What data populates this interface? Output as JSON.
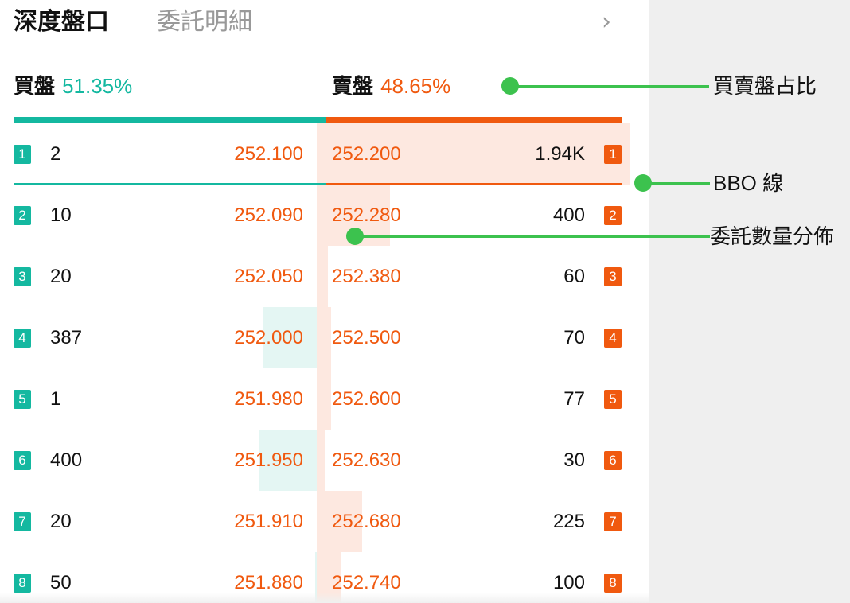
{
  "tabs": {
    "depth": "深度盤口",
    "detail": "委託明細",
    "more_icon": "chevron-right-icon"
  },
  "summary": {
    "buy_label": "買盤",
    "buy_pct": "51.35%",
    "buy_ratio": 0.5135,
    "sell_label": "賣盤",
    "sell_pct": "48.65%"
  },
  "colors": {
    "buy": "#14b8a0",
    "sell": "#f0590f",
    "buy_bar": "#e4f6f3",
    "sell_bar": "#fde8e0",
    "annotation": "#3cc24e"
  },
  "book": [
    {
      "level": "1",
      "bid_qty": "2",
      "bid_price": "252.100",
      "ask_price": "252.200",
      "ask_qty": "1.94K",
      "bid_fill": 0.0,
      "ask_fill": 0.98
    },
    {
      "level": "2",
      "bid_qty": "10",
      "bid_price": "252.090",
      "ask_price": "252.280",
      "ask_qty": "400",
      "ask_fill": 0.21,
      "bid_fill": 0.01
    },
    {
      "level": "3",
      "bid_qty": "20",
      "bid_price": "252.050",
      "ask_price": "252.380",
      "ask_qty": "60",
      "bid_fill": 0.01,
      "ask_fill": 0.03
    },
    {
      "level": "4",
      "bid_qty": "387",
      "bid_price": "252.000",
      "ask_price": "252.500",
      "ask_qty": "70",
      "bid_fill": 0.2,
      "ask_fill": 0.04
    },
    {
      "level": "5",
      "bid_qty": "1",
      "bid_price": "251.980",
      "ask_price": "252.600",
      "ask_qty": "77",
      "bid_fill": 0.0,
      "ask_fill": 0.04
    },
    {
      "level": "6",
      "bid_qty": "400",
      "bid_price": "251.950",
      "ask_price": "252.630",
      "ask_qty": "30",
      "bid_fill": 0.21,
      "ask_fill": 0.02
    },
    {
      "level": "7",
      "bid_qty": "20",
      "bid_price": "251.910",
      "ask_price": "252.680",
      "ask_qty": "225",
      "bid_fill": 0.01,
      "ask_fill": 0.12
    },
    {
      "level": "8",
      "bid_qty": "50",
      "bid_price": "251.880",
      "ask_price": "252.740",
      "ask_qty": "100",
      "bid_fill": 0.03,
      "ask_fill": 0.05
    }
  ],
  "annotations": {
    "ratio": "買賣盤占比",
    "bbo": "BBO 線",
    "distribution": "委託數量分佈"
  }
}
